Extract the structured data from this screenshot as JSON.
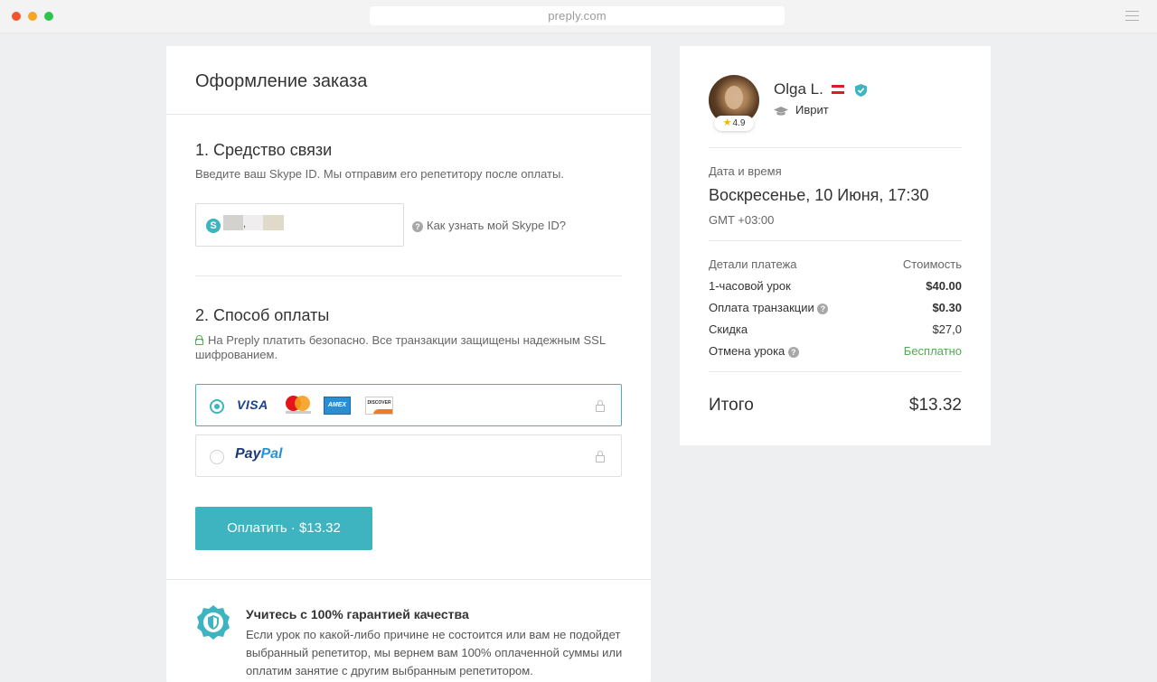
{
  "browser": {
    "url": "preply.com",
    "colors": {
      "close": "#f2542d",
      "minimize": "#f5a623",
      "maximize": "#2ec44a"
    }
  },
  "checkout": {
    "title": "Оформление заказа",
    "contact": {
      "heading": "1. Средство связи",
      "description": "Введите ваш Skype ID. Мы отправим его репетитору после оплаты.",
      "skype_value": ",",
      "help_link": "Как узнать мой Skype ID?"
    },
    "payment": {
      "heading": "2. Способ оплаты",
      "security_note": "На Preply платить безопасно. Все транзакции защищены надежным SSL шифрованием.",
      "options": [
        {
          "id": "card",
          "selected": true,
          "brands": [
            "VISA",
            "mastercard",
            "AMEX",
            "DISCOVER"
          ]
        },
        {
          "id": "paypal",
          "selected": false,
          "label_part1": "Pay",
          "label_part2": "Pal"
        }
      ],
      "card_visa": "VISA",
      "card_amex": "AMEX",
      "card_discover": "DISCOVER",
      "paypal_pay": "Pay",
      "paypal_pal": "Pal",
      "pay_button": "Оплатить · $13.32"
    },
    "guarantee": {
      "title": "Учитесь с 100% гарантией качества",
      "text": "Если урок по какой-либо причине не состоится или вам не подойдет выбранный репетитор, мы вернем вам 100% оплаченной суммы или оплатим занятие с другим выбранным репетитором."
    }
  },
  "summary": {
    "tutor": {
      "name": "Olga L.",
      "rating": "4.9",
      "subject": "Иврит",
      "flag": "Austria"
    },
    "datetime": {
      "label": "Дата и время",
      "value": "Воскресенье, 10 Июня, 17:30",
      "timezone": "GMT +03:00"
    },
    "payment_details": {
      "header_left": "Детали платежа",
      "header_right": "Стоимость",
      "rows": [
        {
          "label": "1-часовой урок",
          "value": "$40.00"
        },
        {
          "label": "Оплата транзакции",
          "value": "$0.30"
        },
        {
          "label": "Скидка",
          "value": "$27,0"
        },
        {
          "label": "Отмена урока",
          "value": "Бесплатно"
        }
      ]
    },
    "total": {
      "label": "Итого",
      "value": "$13.32"
    }
  },
  "colors": {
    "accent": "#3db4c0",
    "success": "#4caf50",
    "background": "#eeeff1"
  }
}
